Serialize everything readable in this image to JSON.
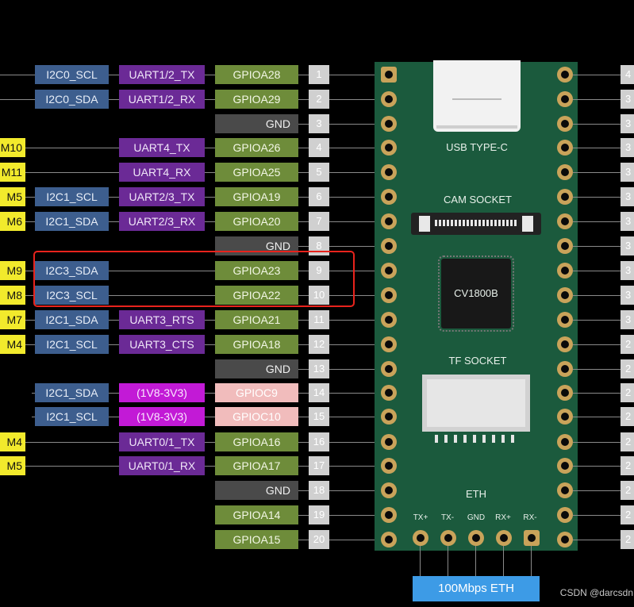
{
  "left_edge_labels": {
    "r4": "M10",
    "r5": "M11",
    "r6": "M5",
    "r7": "M6",
    "r9": "M9",
    "r10": "M8",
    "r11": "M7",
    "r12": "M4",
    "r16": "M4",
    "r17": "M5"
  },
  "pins": [
    {
      "num": "1",
      "gpio": "GPIOA28",
      "alt1": "I2C0_SCL",
      "alt2": "UART1/2_TX"
    },
    {
      "num": "2",
      "gpio": "GPIOA29",
      "alt1": "I2C0_SDA",
      "alt2": "UART1/2_RX"
    },
    {
      "num": "3",
      "gpio": "GND"
    },
    {
      "num": "4",
      "gpio": "GPIOA26",
      "alt2": "UART4_TX"
    },
    {
      "num": "5",
      "gpio": "GPIOA25",
      "alt2": "UART4_RX"
    },
    {
      "num": "6",
      "gpio": "GPIOA19",
      "alt1": "I2C1_SCL",
      "alt2": "UART2/3_TX"
    },
    {
      "num": "7",
      "gpio": "GPIOA20",
      "alt1": "I2C1_SDA",
      "alt2": "UART2/3_RX"
    },
    {
      "num": "8",
      "gpio": "GND"
    },
    {
      "num": "9",
      "gpio": "GPIOA23",
      "alt1": "I2C3_SDA"
    },
    {
      "num": "10",
      "gpio": "GPIOA22",
      "alt1": "I2C3_SCL"
    },
    {
      "num": "11",
      "gpio": "GPIOA21",
      "alt1": "I2C1_SDA",
      "alt2": "UART3_RTS"
    },
    {
      "num": "12",
      "gpio": "GPIOA18",
      "alt1": "I2C1_SCL",
      "alt2": "UART3_CTS"
    },
    {
      "num": "13",
      "gpio": "GND"
    },
    {
      "num": "14",
      "gpio": "GPIOC9",
      "alt1": "I2C1_SDA",
      "alt2": "(1V8-3V3)"
    },
    {
      "num": "15",
      "gpio": "GPIOC10",
      "alt1": "I2C1_SCL",
      "alt2": "(1V8-3V3)"
    },
    {
      "num": "16",
      "gpio": "GPIOA16",
      "alt2": "UART0/1_TX"
    },
    {
      "num": "17",
      "gpio": "GPIOA17",
      "alt2": "UART0/1_RX"
    },
    {
      "num": "18",
      "gpio": "GND"
    },
    {
      "num": "19",
      "gpio": "GPIOA14"
    },
    {
      "num": "20",
      "gpio": "GPIOA15"
    }
  ],
  "right_pin_labels": [
    "4",
    "3",
    "3",
    "3",
    "3",
    "3",
    "3",
    "3",
    "3",
    "3",
    "3",
    "2",
    "2",
    "2",
    "2",
    "2",
    "2",
    "2",
    "2",
    "2"
  ],
  "board": {
    "usb_label": "USB TYPE-C",
    "cam_label": "CAM SOCKET",
    "chip_label": "CV1800B",
    "tf_label": "TF SOCKET",
    "eth_label": "ETH",
    "eth_pins": [
      "TX+",
      "TX-",
      "GND",
      "RX+",
      "RX-"
    ]
  },
  "eth_badge": "100Mbps ETH",
  "watermark": "CSDN @darcsdn",
  "colors": {
    "board": "#1b5a3d",
    "gpio": "#6e8c3a",
    "uart": "#6b2a96",
    "i2c": "#3d5e8e",
    "highlight": "#e8231c",
    "eth_badge": "#3d9be6"
  }
}
